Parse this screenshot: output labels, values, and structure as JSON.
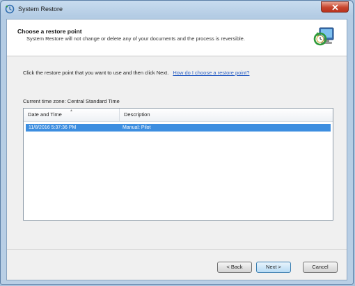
{
  "window": {
    "title": "System Restore"
  },
  "header": {
    "title": "Choose a restore point",
    "subtitle": "System Restore will not change or delete any of your documents and the process is reversible."
  },
  "instruction": {
    "text": "Click the restore point that you want to use and then click Next.",
    "help_link": "How do I choose a restore point?"
  },
  "timezone": "Current time zone: Central Standard Time",
  "list": {
    "columns": [
      "Date and Time",
      "Description"
    ],
    "rows": [
      {
        "date": "11/8/2016 5:37:36 PM",
        "description": "Manual: Pilot",
        "selected": true
      }
    ]
  },
  "buttons": {
    "back": "< Back",
    "next": "Next >",
    "cancel": "Cancel"
  },
  "icons": {
    "window_icon": "system-restore-icon",
    "header_icon": "system-restore-icon",
    "close": "close-icon"
  },
  "colors": {
    "selection": "#3d8ee0",
    "link": "#2a5fc4",
    "close_button": "#c7442c"
  }
}
